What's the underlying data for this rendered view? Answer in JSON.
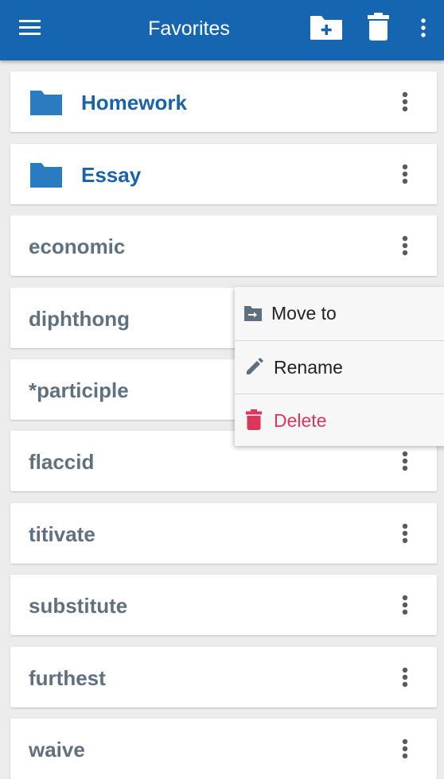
{
  "appbar": {
    "title": "Favorites",
    "menu_icon": "hamburger-menu-icon",
    "new_folder_icon": "folder-plus-icon",
    "delete_icon": "trash-icon",
    "overflow_icon": "more-vertical-icon"
  },
  "items": [
    {
      "label": "Homework",
      "type": "folder"
    },
    {
      "label": "Essay",
      "type": "folder"
    },
    {
      "label": "economic",
      "type": "word"
    },
    {
      "label": "diphthong",
      "type": "word"
    },
    {
      "label": "*participle",
      "type": "word"
    },
    {
      "label": "flaccid",
      "type": "word"
    },
    {
      "label": "titivate",
      "type": "word"
    },
    {
      "label": "substitute",
      "type": "word"
    },
    {
      "label": "furthest",
      "type": "word"
    },
    {
      "label": "waive",
      "type": "word"
    }
  ],
  "context_menu": {
    "move_to": "Move to",
    "rename": "Rename",
    "delete": "Delete"
  },
  "colors": {
    "appbar": "#1565b0",
    "folder": "#1a63a8",
    "word_text": "#5f7180",
    "delete": "#d9385a"
  }
}
